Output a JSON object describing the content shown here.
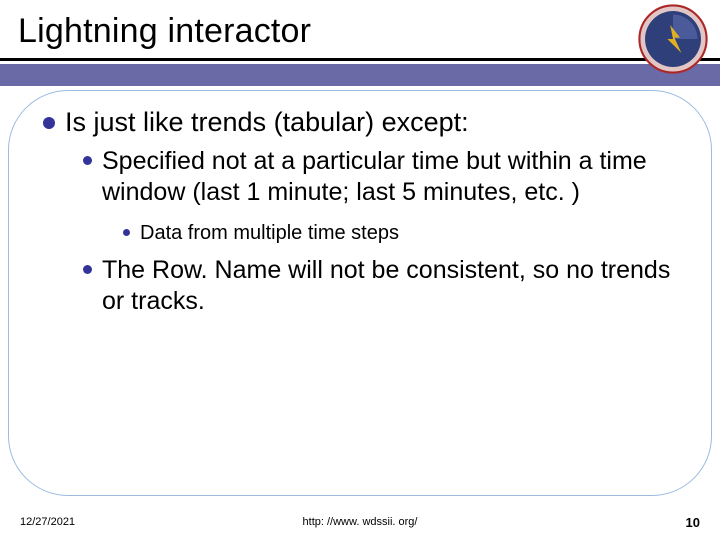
{
  "slide": {
    "title": "Lightning interactor",
    "footer": {
      "date": "12/27/2021",
      "link": "http: //www. wdssii. org/",
      "page": "10"
    },
    "logo": {
      "name": "nssl-logo",
      "alt": "National Severe Storms Laboratory"
    }
  },
  "content": {
    "l1": "Is just like trends (tabular) except:",
    "l2a": "Specified not at a particular time but within a time window (last 1 minute; last 5 minutes, etc. )",
    "l3a": "Data from multiple time steps",
    "l2b": "The Row. Name will not be consistent, so no trends or tracks."
  },
  "colors": {
    "accent": "#333399",
    "band": "#6a6aa6",
    "roundedBorder": "#9bbbe0"
  }
}
